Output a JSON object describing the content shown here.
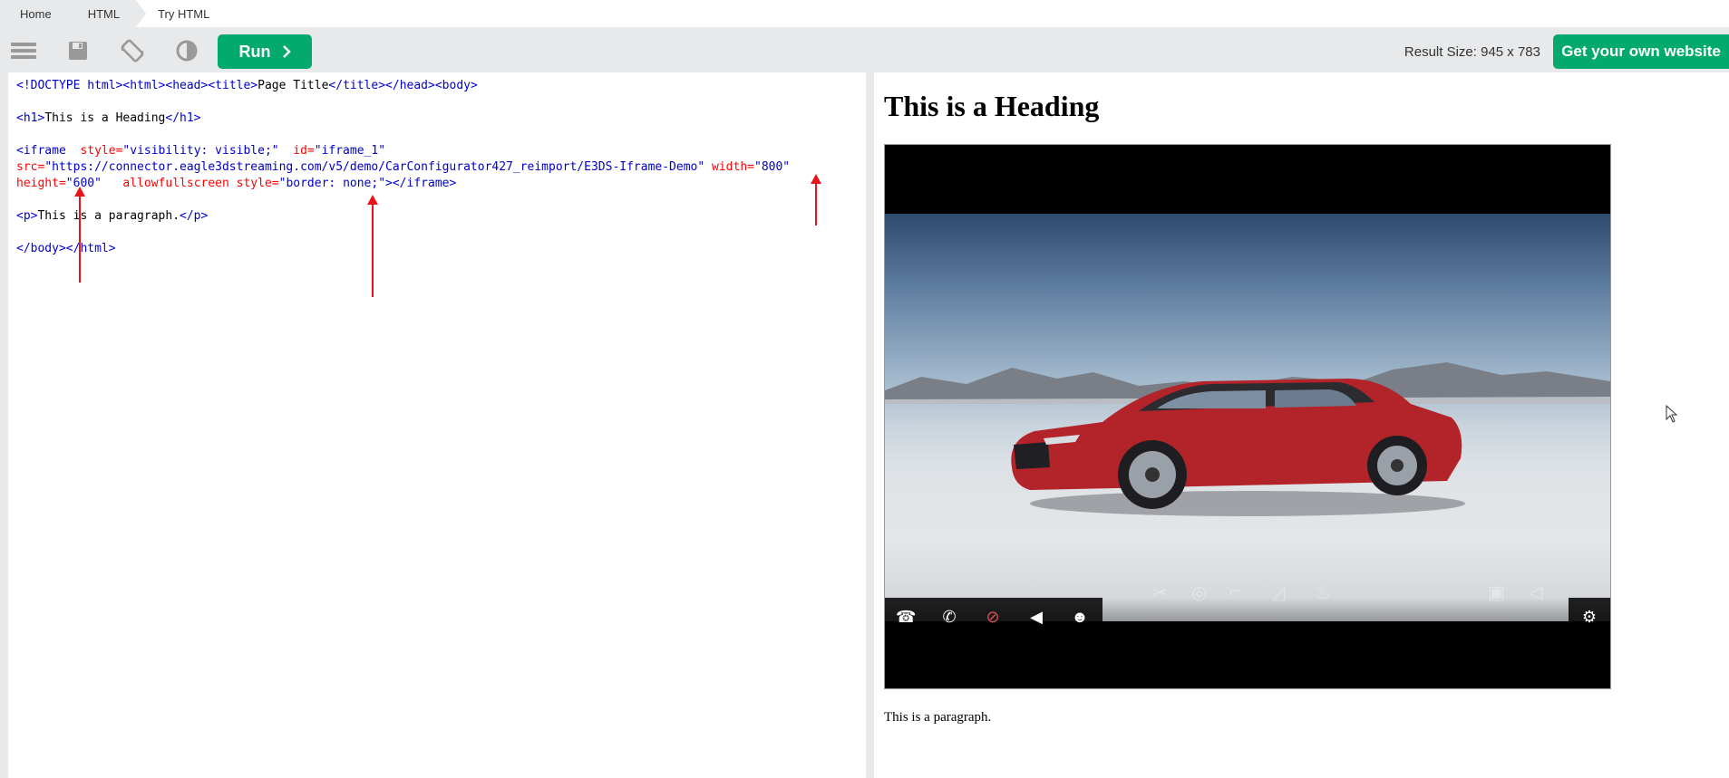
{
  "breadcrumb": {
    "items": [
      "Home",
      "HTML",
      "Try HTML"
    ]
  },
  "toolbar": {
    "run_label": "Run",
    "result_size": "Result Size: 945 x 783",
    "own_site_label": "Get your own website",
    "icons": [
      "menu-icon",
      "save-icon",
      "rotate-icon",
      "theme-contrast-icon"
    ]
  },
  "code": {
    "line1": {
      "doctype": "<!DOCTYPE html>",
      "t1": "<html>",
      "t2": "<head>",
      "t3": "<title>",
      "text": "Page Title",
      "t4": "</title>",
      "t5": "</head>",
      "t6": "<body>"
    },
    "line2": {
      "open": "<h1>",
      "text": "This is a Heading",
      "close": "</h1>"
    },
    "line3": {
      "open": "<iframe",
      "a1": "style=",
      "v1": "\"visibility: visible;\"",
      "a2": "id=",
      "v2": "\"iframe_1\""
    },
    "line4": {
      "a1": "src=",
      "v1": "\"https://connector.eagle3dstreaming.com/v5/demo/CarConfigurator427_reimport/E3DS-Iframe-Demo\"",
      "a2": "width=",
      "v2": "\"800\""
    },
    "line5": {
      "a1": "height=",
      "v1": "\"600\"",
      "a2": "allowfullscreen",
      "a3": "style=",
      "v3": "\"border: none;\"",
      "close": "></iframe>"
    },
    "line6": {
      "open": "<p>",
      "text": "This is a paragraph.",
      "close": "</p>"
    },
    "line7": {
      "close1": "</body>",
      "close2": "</html>"
    }
  },
  "result": {
    "heading": "This is a Heading",
    "paragraph": "This is a paragraph."
  },
  "colors": {
    "accent": "#04aa6d",
    "annotation_arrow": "#e8141b"
  }
}
